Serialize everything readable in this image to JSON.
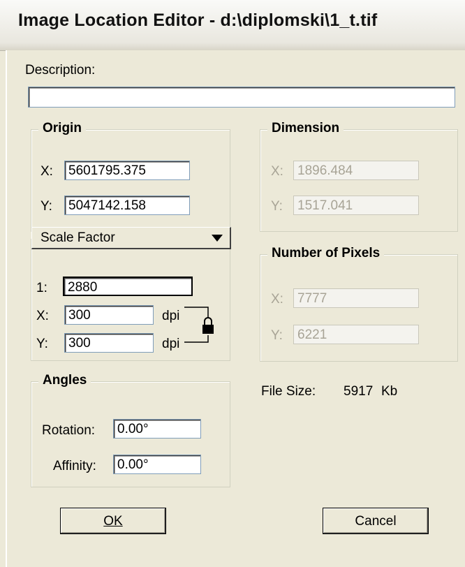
{
  "window": {
    "title": "Image Location Editor - d:\\diplomski\\1_t.tif"
  },
  "description": {
    "label": "Description:",
    "value": ""
  },
  "origin": {
    "title": "Origin",
    "x_label": "X:",
    "x_value": "5601795.375",
    "y_label": "Y:",
    "y_value": "5047142.158"
  },
  "dimension": {
    "title": "Dimension",
    "x_label": "X:",
    "x_value": "1896.484",
    "y_label": "Y:",
    "y_value": "1517.041"
  },
  "scale": {
    "mode_label": "Scale Factor",
    "ratio_label": "1:",
    "ratio_value": "2880",
    "x_label": "X:",
    "x_value": "300",
    "x_unit": "dpi",
    "y_label": "Y:",
    "y_value": "300",
    "y_unit": "dpi",
    "icon": "lock-icon"
  },
  "pixels": {
    "title": "Number of Pixels",
    "x_label": "X:",
    "x_value": "7777",
    "y_label": "Y:",
    "y_value": "6221"
  },
  "angles": {
    "title": "Angles",
    "rotation_label": "Rotation:",
    "rotation_value": "0.00°",
    "affinity_label": "Affinity:",
    "affinity_value": "0.00°"
  },
  "filesize": {
    "label": "File Size:",
    "value": "5917",
    "unit": "Kb"
  },
  "buttons": {
    "ok_label": "OK",
    "cancel_label": "Cancel"
  }
}
